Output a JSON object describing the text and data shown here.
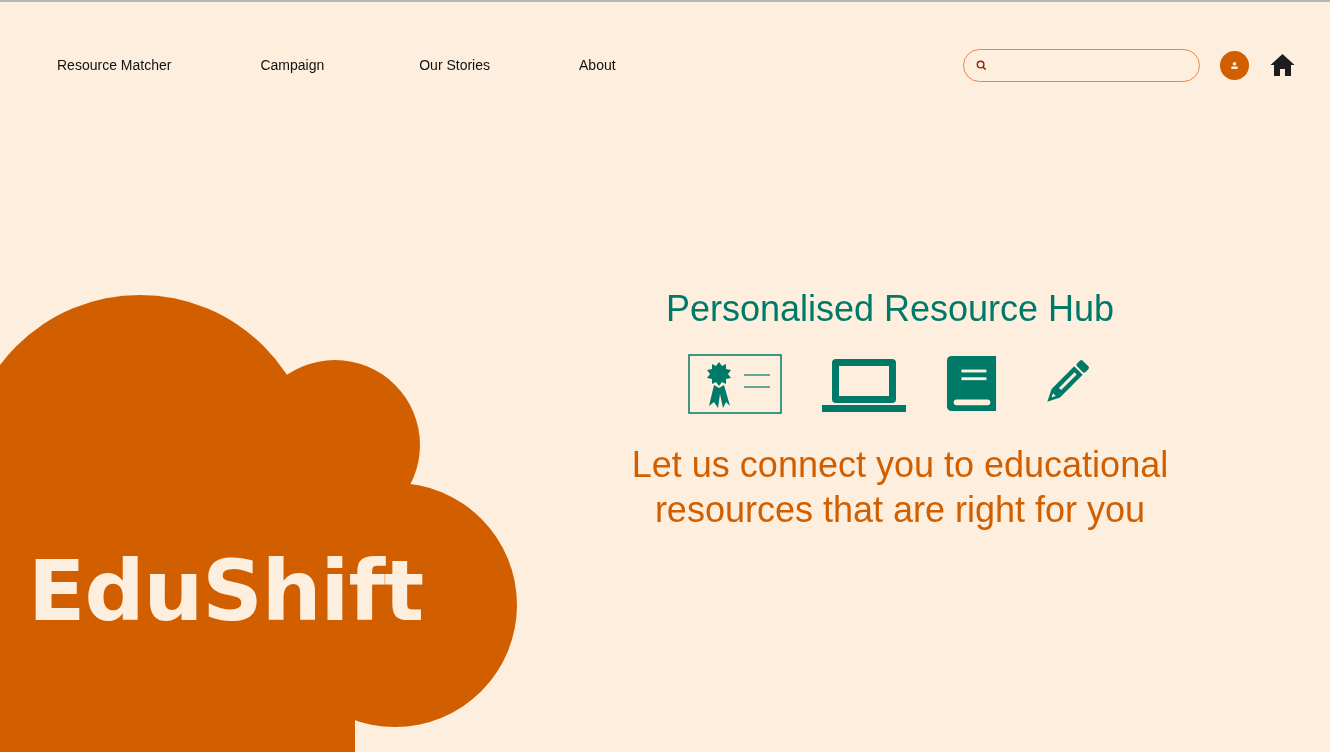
{
  "nav": {
    "links": [
      "Resource Matcher",
      "Campaign",
      "Our Stories",
      "About"
    ]
  },
  "logo": {
    "text": "EduShift"
  },
  "hero": {
    "title": "Personalised Resource Hub",
    "tagline": "Let us connect you to educational resources that are right for you"
  }
}
